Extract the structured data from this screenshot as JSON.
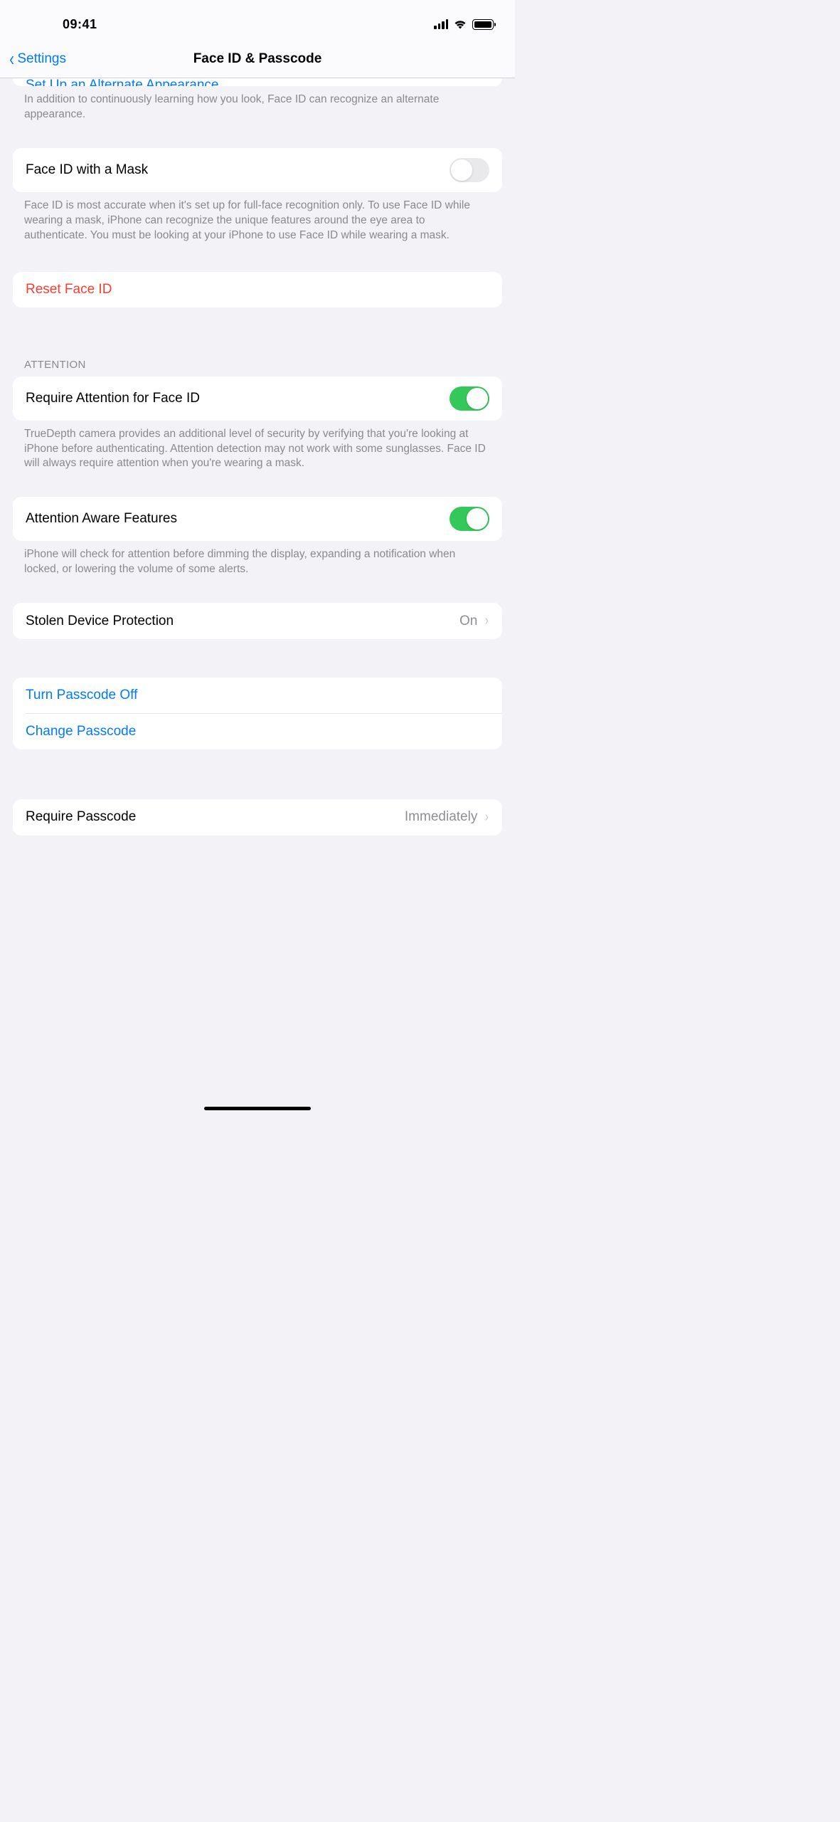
{
  "status": {
    "time": "09:41"
  },
  "nav": {
    "back": "Settings",
    "title": "Face ID & Passcode"
  },
  "alt_appearance": {
    "partial_link": "Set Up an Alternate Appearance",
    "footer": "In addition to continuously learning how you look, Face ID can recognize an alternate appearance."
  },
  "mask": {
    "label": "Face ID with a Mask",
    "enabled": false,
    "footer": "Face ID is most accurate when it's set up for full-face recognition only. To use Face ID while wearing a mask, iPhone can recognize the unique features around the eye area to authenticate. You must be looking at your iPhone to use Face ID while wearing a mask."
  },
  "reset": {
    "label": "Reset Face ID"
  },
  "attention": {
    "header": "ATTENTION",
    "require": {
      "label": "Require Attention for Face ID",
      "enabled": true,
      "footer": "TrueDepth camera provides an additional level of security by verifying that you're looking at iPhone before authenticating. Attention detection may not work with some sunglasses. Face ID will always require attention when you're wearing a mask."
    },
    "aware": {
      "label": "Attention Aware Features",
      "enabled": true,
      "footer": "iPhone will check for attention before dimming the display, expanding a notification when locked, or lowering the volume of some alerts."
    }
  },
  "stolen": {
    "label": "Stolen Device Protection",
    "value": "On"
  },
  "passcode": {
    "turn_off": "Turn Passcode Off",
    "change": "Change Passcode"
  },
  "require_passcode": {
    "label": "Require Passcode",
    "value": "Immediately"
  }
}
